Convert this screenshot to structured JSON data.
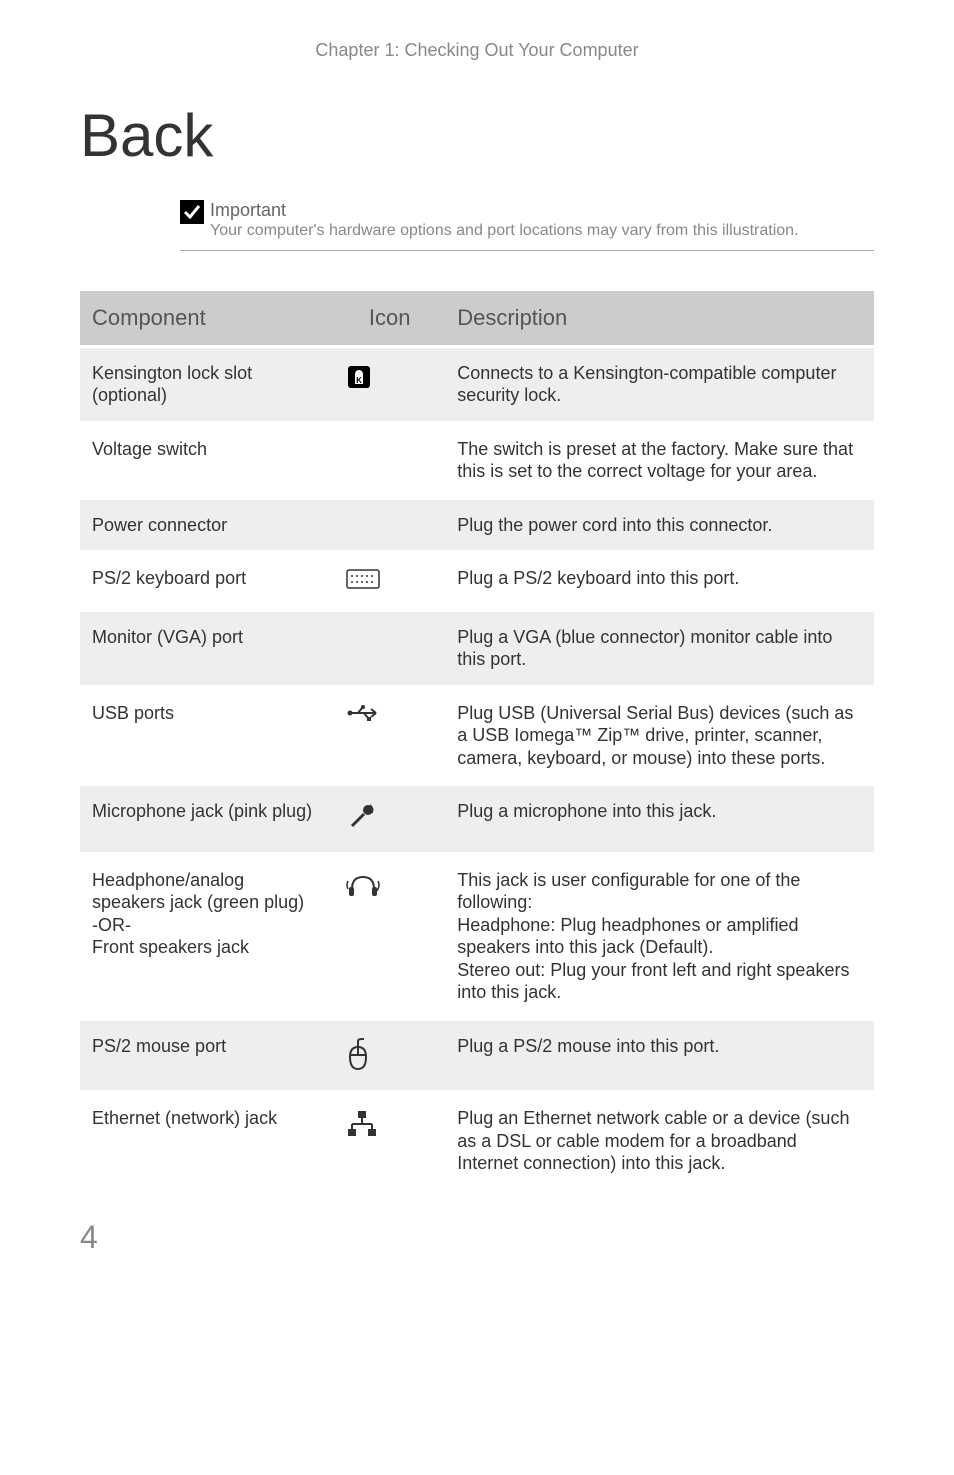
{
  "chapter_heading": "Chapter 1: Checking Out Your Computer",
  "section_title": "Back",
  "callout": {
    "title": "Important",
    "text": "Your computer's hardware options and port locations may vary from this illustration."
  },
  "table": {
    "headers": {
      "component": "Component",
      "icon": "Icon",
      "description": "Description"
    },
    "rows": [
      {
        "component": "Kensington lock slot (optional)",
        "icon_name": "lock-icon",
        "description": "Connects to a Kensington-compatible computer security lock."
      },
      {
        "component": "Voltage switch",
        "icon_name": "",
        "description": "The switch is preset at the factory. Make sure that this is set to the correct voltage for your area."
      },
      {
        "component": "Power connector",
        "icon_name": "",
        "description": "Plug the power cord into this connector."
      },
      {
        "component": "PS/2 keyboard port",
        "icon_name": "keyboard-icon",
        "description": "Plug a PS/2 keyboard into this port."
      },
      {
        "component": "Monitor (VGA) port",
        "icon_name": "",
        "description": "Plug a VGA (blue connector) monitor cable into this port."
      },
      {
        "component": "USB ports",
        "icon_name": "usb-icon",
        "description": "Plug USB (Universal Serial Bus) devices (such as a USB Iomega™ Zip™ drive, printer, scanner, camera, keyboard, or mouse) into these ports."
      },
      {
        "component": "Microphone jack (pink plug)",
        "icon_name": "microphone-icon",
        "description": "Plug a microphone into this jack."
      },
      {
        "component": "Headphone/analog speakers jack (green plug)\n-OR-\nFront speakers jack",
        "icon_name": "headphone-icon",
        "description": "This jack is user configurable for one of the following:\nHeadphone: Plug headphones or amplified speakers into this jack (Default).\nStereo out: Plug your front left and right speakers into this jack."
      },
      {
        "component": "PS/2 mouse port",
        "icon_name": "mouse-icon",
        "description": "Plug a PS/2 mouse into this port."
      },
      {
        "component": "Ethernet (network) jack",
        "icon_name": "network-icon",
        "description": "Plug an Ethernet network cable or a device (such as a DSL or cable modem for a broadband Internet connection) into this jack."
      }
    ]
  },
  "page_number": "4"
}
